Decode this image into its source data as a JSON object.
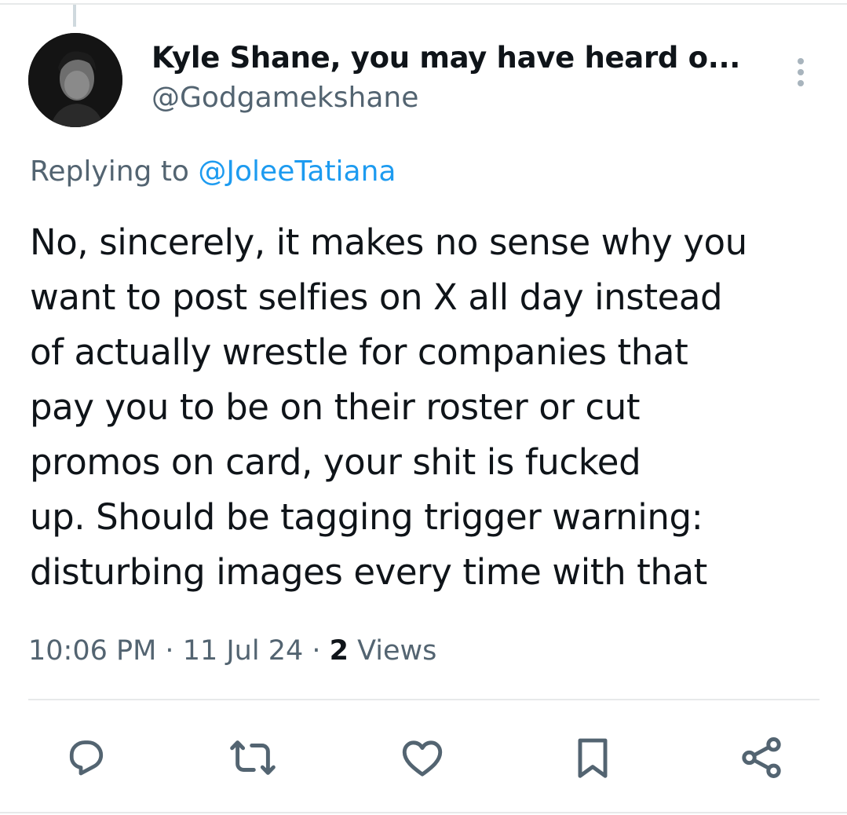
{
  "tweet": {
    "author": {
      "display_name": "Kyle Shane, you may have heard o...",
      "handle": "@Godgamekshane"
    },
    "replying_prefix": "Replying to ",
    "replying_to": "@JoleeTatiana",
    "text": "No, sincerely, it makes no sense why you\nwant to post selfies on X all day instead\nof actually wrestle for companies that\npay you to be on their roster or cut\npromos on card, your shit is fucked\nup. Should be tagging trigger warning:\ndisturbing images every time with that",
    "time": "10:06 PM",
    "separator": " · ",
    "date": "11 Jul 24",
    "views_count": "2",
    "views_label": " Views"
  },
  "icons": {
    "more": "more-vertical-icon",
    "reply": "reply-icon",
    "retweet": "retweet-icon",
    "like": "heart-icon",
    "bookmark": "bookmark-icon",
    "share": "share-icon"
  },
  "colors": {
    "text_primary": "#0f1419",
    "text_secondary": "#536471",
    "link": "#1d9bf0",
    "border": "#e7e9ea"
  }
}
